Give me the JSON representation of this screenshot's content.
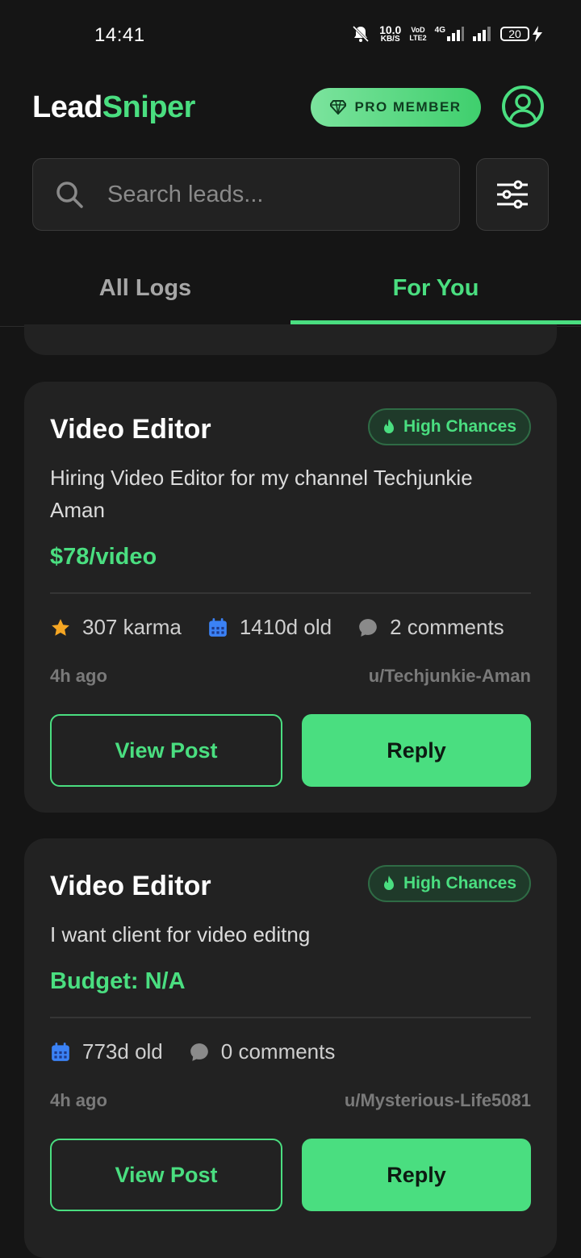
{
  "status_bar": {
    "time": "14:41",
    "net_speed_value": "10.0",
    "net_speed_unit": "KB/S",
    "volte_top": "VoD",
    "volte_bottom": "LTE2",
    "network": "4G",
    "battery": "20"
  },
  "header": {
    "logo_part1": "Lead",
    "logo_part2": "Sniper",
    "pro_badge_label": "PRO MEMBER"
  },
  "search": {
    "placeholder": "Search leads...",
    "value": ""
  },
  "tabs": [
    {
      "label": "All Logs",
      "active": false
    },
    {
      "label": "For You",
      "active": true
    }
  ],
  "leads": [
    {
      "title": "Video Editor",
      "badge": "High Chances",
      "description": "Hiring Video Editor for my channel Techjunkie Aman",
      "budget": "$78/video",
      "karma": "307 karma",
      "age": "1410d old",
      "comments": "2 comments",
      "posted": "4h ago",
      "user": "u/Techjunkie-Aman",
      "view_label": "View Post",
      "reply_label": "Reply"
    },
    {
      "title": "Video Editor",
      "badge": "High Chances",
      "description": "I want client for video editng",
      "budget": "Budget: N/A",
      "age": "773d old",
      "comments": "0 comments",
      "posted": "4h ago",
      "user": "u/Mysterious-Life5081",
      "view_label": "View Post",
      "reply_label": "Reply"
    }
  ],
  "colors": {
    "accent": "#4ade80",
    "background": "#151515",
    "card": "#222222",
    "star": "#f5a623",
    "calendar": "#3b82f6"
  }
}
